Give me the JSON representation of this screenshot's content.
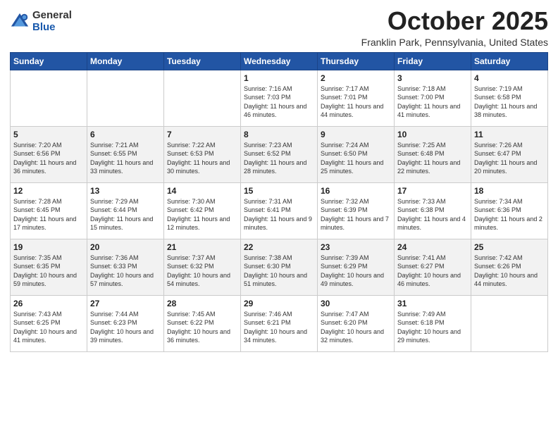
{
  "logo": {
    "general": "General",
    "blue": "Blue"
  },
  "header": {
    "title": "October 2025",
    "subtitle": "Franklin Park, Pennsylvania, United States"
  },
  "days_of_week": [
    "Sunday",
    "Monday",
    "Tuesday",
    "Wednesday",
    "Thursday",
    "Friday",
    "Saturday"
  ],
  "weeks": [
    [
      {
        "day": "",
        "info": ""
      },
      {
        "day": "",
        "info": ""
      },
      {
        "day": "",
        "info": ""
      },
      {
        "day": "1",
        "info": "Sunrise: 7:16 AM\nSunset: 7:03 PM\nDaylight: 11 hours and 46 minutes."
      },
      {
        "day": "2",
        "info": "Sunrise: 7:17 AM\nSunset: 7:01 PM\nDaylight: 11 hours and 44 minutes."
      },
      {
        "day": "3",
        "info": "Sunrise: 7:18 AM\nSunset: 7:00 PM\nDaylight: 11 hours and 41 minutes."
      },
      {
        "day": "4",
        "info": "Sunrise: 7:19 AM\nSunset: 6:58 PM\nDaylight: 11 hours and 38 minutes."
      }
    ],
    [
      {
        "day": "5",
        "info": "Sunrise: 7:20 AM\nSunset: 6:56 PM\nDaylight: 11 hours and 36 minutes."
      },
      {
        "day": "6",
        "info": "Sunrise: 7:21 AM\nSunset: 6:55 PM\nDaylight: 11 hours and 33 minutes."
      },
      {
        "day": "7",
        "info": "Sunrise: 7:22 AM\nSunset: 6:53 PM\nDaylight: 11 hours and 30 minutes."
      },
      {
        "day": "8",
        "info": "Sunrise: 7:23 AM\nSunset: 6:52 PM\nDaylight: 11 hours and 28 minutes."
      },
      {
        "day": "9",
        "info": "Sunrise: 7:24 AM\nSunset: 6:50 PM\nDaylight: 11 hours and 25 minutes."
      },
      {
        "day": "10",
        "info": "Sunrise: 7:25 AM\nSunset: 6:48 PM\nDaylight: 11 hours and 22 minutes."
      },
      {
        "day": "11",
        "info": "Sunrise: 7:26 AM\nSunset: 6:47 PM\nDaylight: 11 hours and 20 minutes."
      }
    ],
    [
      {
        "day": "12",
        "info": "Sunrise: 7:28 AM\nSunset: 6:45 PM\nDaylight: 11 hours and 17 minutes."
      },
      {
        "day": "13",
        "info": "Sunrise: 7:29 AM\nSunset: 6:44 PM\nDaylight: 11 hours and 15 minutes."
      },
      {
        "day": "14",
        "info": "Sunrise: 7:30 AM\nSunset: 6:42 PM\nDaylight: 11 hours and 12 minutes."
      },
      {
        "day": "15",
        "info": "Sunrise: 7:31 AM\nSunset: 6:41 PM\nDaylight: 11 hours and 9 minutes."
      },
      {
        "day": "16",
        "info": "Sunrise: 7:32 AM\nSunset: 6:39 PM\nDaylight: 11 hours and 7 minutes."
      },
      {
        "day": "17",
        "info": "Sunrise: 7:33 AM\nSunset: 6:38 PM\nDaylight: 11 hours and 4 minutes."
      },
      {
        "day": "18",
        "info": "Sunrise: 7:34 AM\nSunset: 6:36 PM\nDaylight: 11 hours and 2 minutes."
      }
    ],
    [
      {
        "day": "19",
        "info": "Sunrise: 7:35 AM\nSunset: 6:35 PM\nDaylight: 10 hours and 59 minutes."
      },
      {
        "day": "20",
        "info": "Sunrise: 7:36 AM\nSunset: 6:33 PM\nDaylight: 10 hours and 57 minutes."
      },
      {
        "day": "21",
        "info": "Sunrise: 7:37 AM\nSunset: 6:32 PM\nDaylight: 10 hours and 54 minutes."
      },
      {
        "day": "22",
        "info": "Sunrise: 7:38 AM\nSunset: 6:30 PM\nDaylight: 10 hours and 51 minutes."
      },
      {
        "day": "23",
        "info": "Sunrise: 7:39 AM\nSunset: 6:29 PM\nDaylight: 10 hours and 49 minutes."
      },
      {
        "day": "24",
        "info": "Sunrise: 7:41 AM\nSunset: 6:27 PM\nDaylight: 10 hours and 46 minutes."
      },
      {
        "day": "25",
        "info": "Sunrise: 7:42 AM\nSunset: 6:26 PM\nDaylight: 10 hours and 44 minutes."
      }
    ],
    [
      {
        "day": "26",
        "info": "Sunrise: 7:43 AM\nSunset: 6:25 PM\nDaylight: 10 hours and 41 minutes."
      },
      {
        "day": "27",
        "info": "Sunrise: 7:44 AM\nSunset: 6:23 PM\nDaylight: 10 hours and 39 minutes."
      },
      {
        "day": "28",
        "info": "Sunrise: 7:45 AM\nSunset: 6:22 PM\nDaylight: 10 hours and 36 minutes."
      },
      {
        "day": "29",
        "info": "Sunrise: 7:46 AM\nSunset: 6:21 PM\nDaylight: 10 hours and 34 minutes."
      },
      {
        "day": "30",
        "info": "Sunrise: 7:47 AM\nSunset: 6:20 PM\nDaylight: 10 hours and 32 minutes."
      },
      {
        "day": "31",
        "info": "Sunrise: 7:49 AM\nSunset: 6:18 PM\nDaylight: 10 hours and 29 minutes."
      },
      {
        "day": "",
        "info": ""
      }
    ]
  ]
}
